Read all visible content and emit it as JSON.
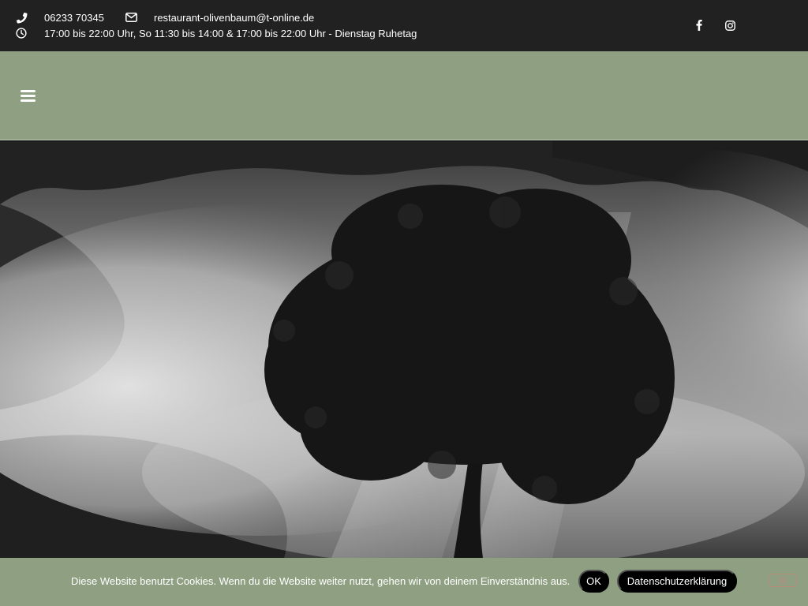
{
  "topbar": {
    "phone": "06233 70345",
    "email": "restaurant-olivenbaum@t-online.de",
    "hours": "17:00 bis 22:00 Uhr, So 11:30 bis 14:00 & 17:00 bis 22:00 Uhr - Dienstag Ruhetag",
    "icons": [
      "phone-icon",
      "envelope-icon",
      "clock-icon",
      "facebook-icon",
      "instagram-icon"
    ]
  },
  "navbar": {
    "menu_icon": "hamburger-menu-icon"
  },
  "hero": {
    "image": "black-and-white tree in morning fog"
  },
  "cookie": {
    "message": "Diese Website benutzt Cookies. Wenn du die Website weiter nutzt, gehen wir von deinem Einverständnis aus.",
    "ok_label": "OK",
    "privacy_label": "Datenschutzerklärung"
  },
  "colors": {
    "topbar_bg": "#212121",
    "nav_bg": "#8fa082",
    "button_bg": "#000000"
  }
}
